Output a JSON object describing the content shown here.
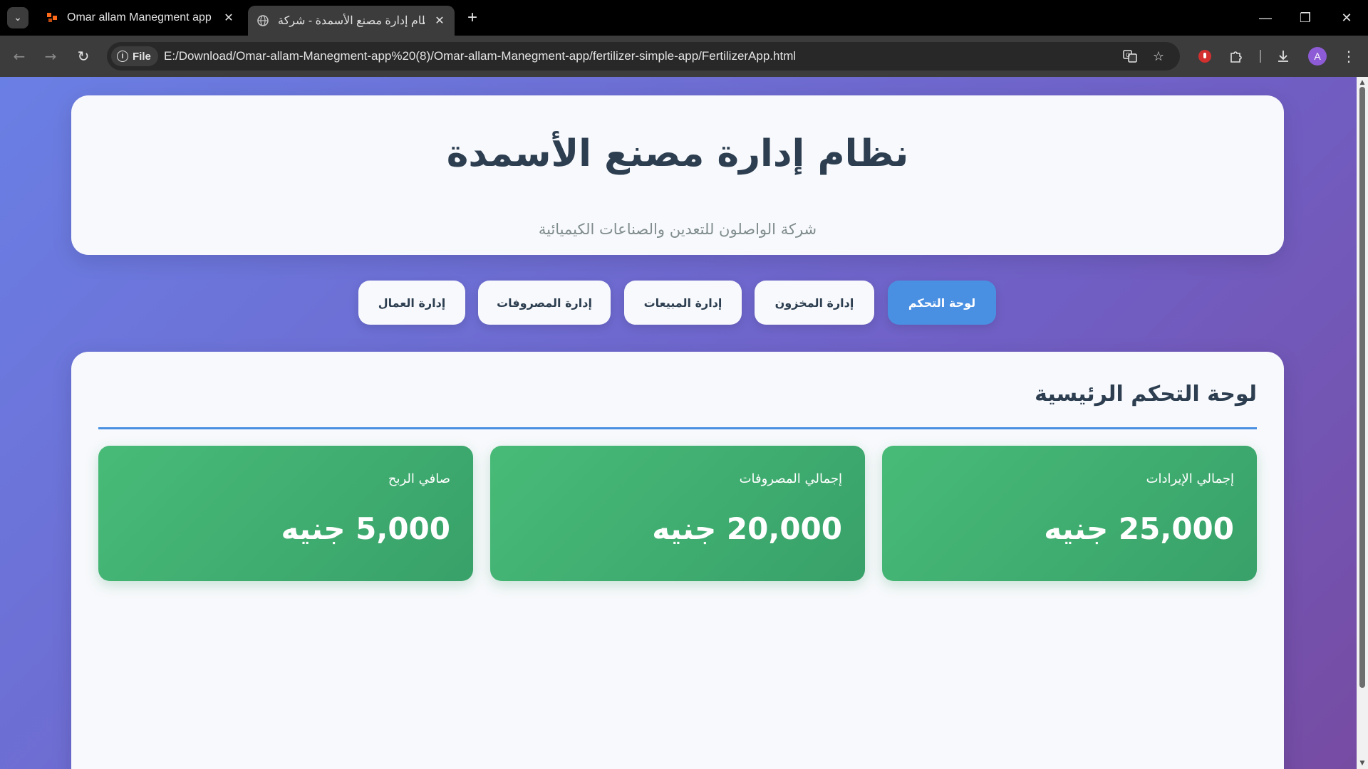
{
  "browser": {
    "tabs": [
      {
        "title": "Omar allam Manegment app - I",
        "active": false
      },
      {
        "title": "نظام إدارة مصنع الأسمدة - شركة",
        "active": true
      }
    ],
    "site_chip": "File",
    "url": "E:/Download/Omar-allam-Manegment-app%20(8)/Omar-allam-Manegment-app/fertilizer-simple-app/FertilizerApp.html",
    "profile_initial": "A"
  },
  "header": {
    "title": "نظام إدارة مصنع الأسمدة",
    "subtitle": "شركة الواصلون للتعدين والصناعات الكيميائية"
  },
  "nav": {
    "tabs": [
      {
        "label": "لوحة التحكم",
        "active": true
      },
      {
        "label": "إدارة المخزون",
        "active": false
      },
      {
        "label": "إدارة المبيعات",
        "active": false
      },
      {
        "label": "إدارة المصروفات",
        "active": false
      },
      {
        "label": "إدارة العمال",
        "active": false
      }
    ]
  },
  "dashboard": {
    "title": "لوحة التحكم الرئيسية",
    "stats": [
      {
        "label": "إجمالي الإيرادات",
        "value": "25,000 جنيه"
      },
      {
        "label": "إجمالي المصروفات",
        "value": "20,000 جنيه"
      },
      {
        "label": "صافي الربح",
        "value": "5,000 جنيه"
      }
    ]
  },
  "colors": {
    "accent": "#4a90e2",
    "stat_card": "#48bb78",
    "title_text": "#2c3e50"
  }
}
